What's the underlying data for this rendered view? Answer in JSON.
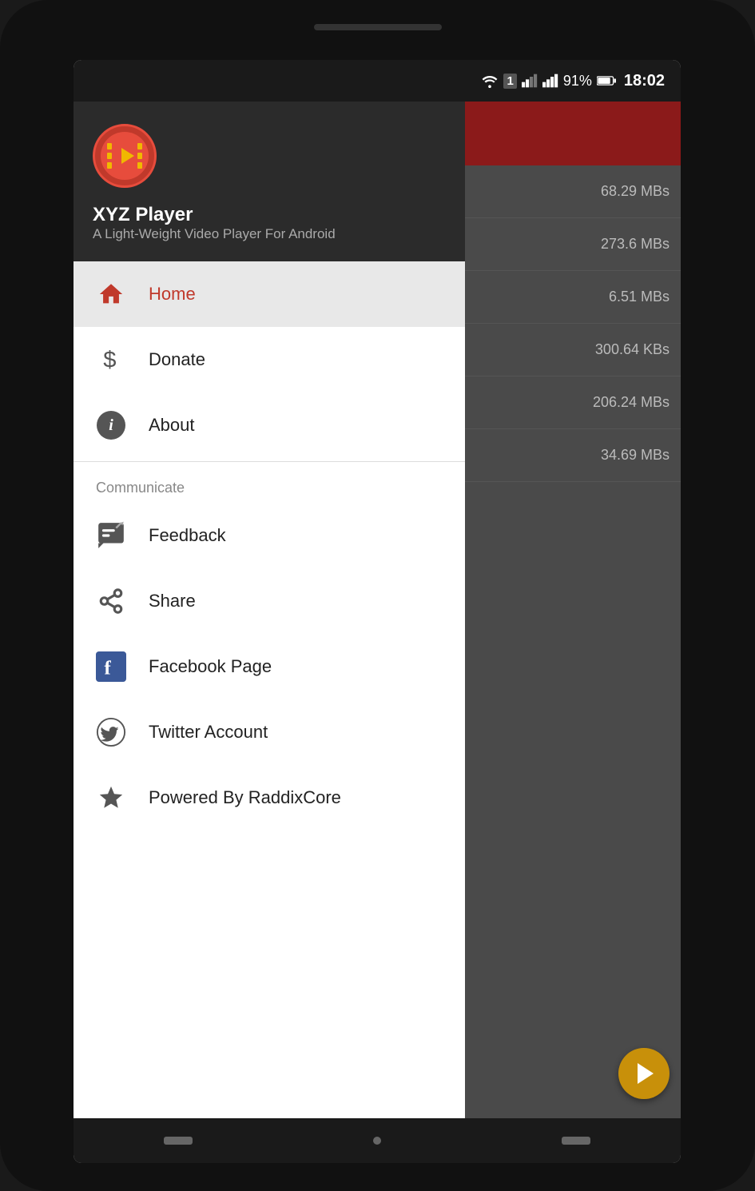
{
  "statusBar": {
    "time": "18:02",
    "battery": "91%",
    "icons": [
      "wifi",
      "sim1",
      "signal1",
      "signal2",
      "battery"
    ]
  },
  "drawer": {
    "app": {
      "name": "XYZ Player",
      "tagline": "A Light-Weight Video Player For Android"
    },
    "navItems": [
      {
        "id": "home",
        "label": "Home",
        "icon": "home",
        "active": true
      },
      {
        "id": "donate",
        "label": "Donate",
        "icon": "dollar",
        "active": false
      },
      {
        "id": "about",
        "label": "About",
        "icon": "info",
        "active": false
      }
    ],
    "sectionTitle": "Communicate",
    "communicateItems": [
      {
        "id": "feedback",
        "label": "Feedback",
        "icon": "feedback"
      },
      {
        "id": "share",
        "label": "Share",
        "icon": "share"
      },
      {
        "id": "facebook",
        "label": "Facebook Page",
        "icon": "facebook"
      },
      {
        "id": "twitter",
        "label": "Twitter Account",
        "icon": "twitter"
      },
      {
        "id": "raddixcore",
        "label": "Powered By RaddixCore",
        "icon": "star"
      }
    ]
  },
  "mainContent": {
    "fileSizes": [
      "68.29 MBs",
      "273.6 MBs",
      "6.51 MBs",
      "300.64 KBs",
      "206.24 MBs",
      "34.69 MBs"
    ]
  }
}
